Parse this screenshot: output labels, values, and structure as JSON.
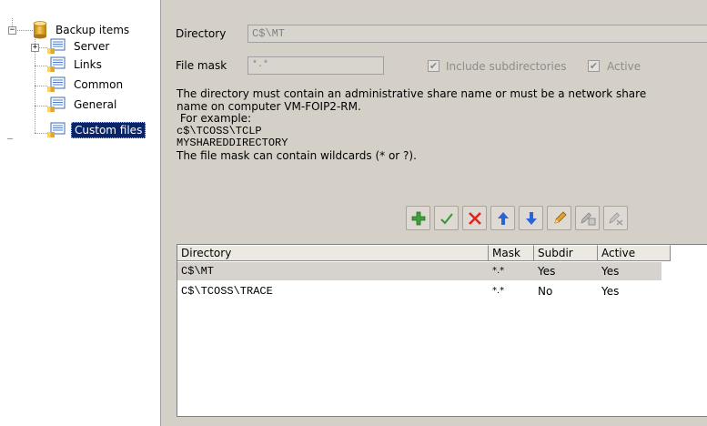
{
  "tree": {
    "root": "Backup items",
    "root_expander": "−",
    "children": [
      {
        "label": "Server",
        "expander": "+"
      },
      {
        "label": "Links"
      },
      {
        "label": "Common"
      },
      {
        "label": "General"
      },
      {
        "label": "Custom files",
        "selected": true
      }
    ]
  },
  "form": {
    "directory_label": "Directory",
    "directory_value": "C$\\MT",
    "mask_label": "File mask",
    "mask_value": "*.*",
    "include_subdirs_label": "Include subdirectories",
    "include_subdirs_checked": true,
    "active_label": "Active",
    "active_checked": true,
    "check_glyph": "✔"
  },
  "help": {
    "line1": "The directory must contain an administrative share name or must be a network share",
    "line2": "name on computer VM-FOIP2-RM.",
    "line3": " For example:",
    "line4": "c$\\TCOSS\\TCLP",
    "line5": "MYSHAREDDIRECTORY",
    "line6": "The file mask can contain wildcards (* or ?)."
  },
  "toolbar": {
    "buttons": [
      "add",
      "accept",
      "delete",
      "move-up",
      "move-down",
      "edit",
      "rename",
      "disable"
    ],
    "colors": {
      "add": "#3ea23a",
      "accept": "#2f9b2f",
      "delete": "#e0261c",
      "arrow": "#2e63d6",
      "edit": "#d08a1a",
      "disabled": "#9a9a9a"
    }
  },
  "list": {
    "columns": [
      "Directory",
      "Mask",
      "Subdir",
      "Active"
    ],
    "rows": [
      {
        "directory": "C$\\MT",
        "mask": "*.*",
        "subdir": "Yes",
        "active": "Yes",
        "selected": true
      },
      {
        "directory": "C$\\TCOSS\\TRACE",
        "mask": "*.*",
        "subdir": "No",
        "active": "Yes",
        "selected": false
      }
    ]
  }
}
